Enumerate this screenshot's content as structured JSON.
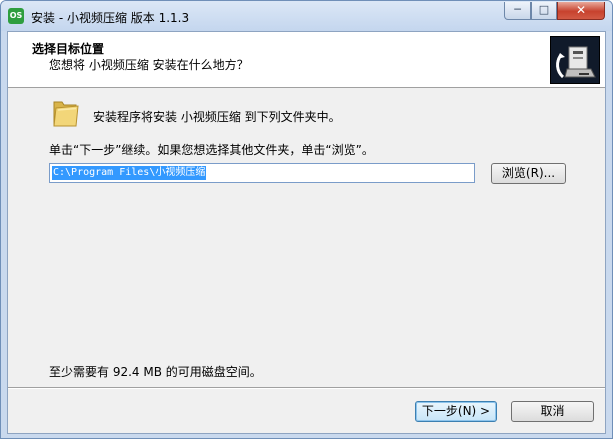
{
  "window": {
    "title": "安装 - 小视频压缩 版本 1.1.3",
    "app_icon_text": "OS",
    "minimize_glyph": "─",
    "maximize_glyph": "□",
    "close_glyph": "✕"
  },
  "header": {
    "title": "选择目标位置",
    "subtitle": "您想将 小视频压缩 安装在什么地方？"
  },
  "body": {
    "install_line": "安装程序将安装 小视频压缩 到下列文件夹中。",
    "instruction": "单击“下一步”继续。如果您想选择其他文件夹，单击“浏览”。",
    "path_value": "C:\\Program Files\\小视频压缩",
    "browse_label": "浏览(R)...",
    "disk_space": "至少需要有 92.4 MB 的可用磁盘空间。"
  },
  "footer": {
    "next_label": "下一步(N) >",
    "cancel_label": "取消"
  },
  "colors": {
    "selection": "#3399ff",
    "titlebar": "#c4d6ee",
    "close_button": "#c7422e",
    "folder": "#e8c860"
  },
  "icons": [
    "app-icon",
    "minimize-icon",
    "maximize-icon",
    "close-icon",
    "folder-icon",
    "installer-logo-icon"
  ]
}
